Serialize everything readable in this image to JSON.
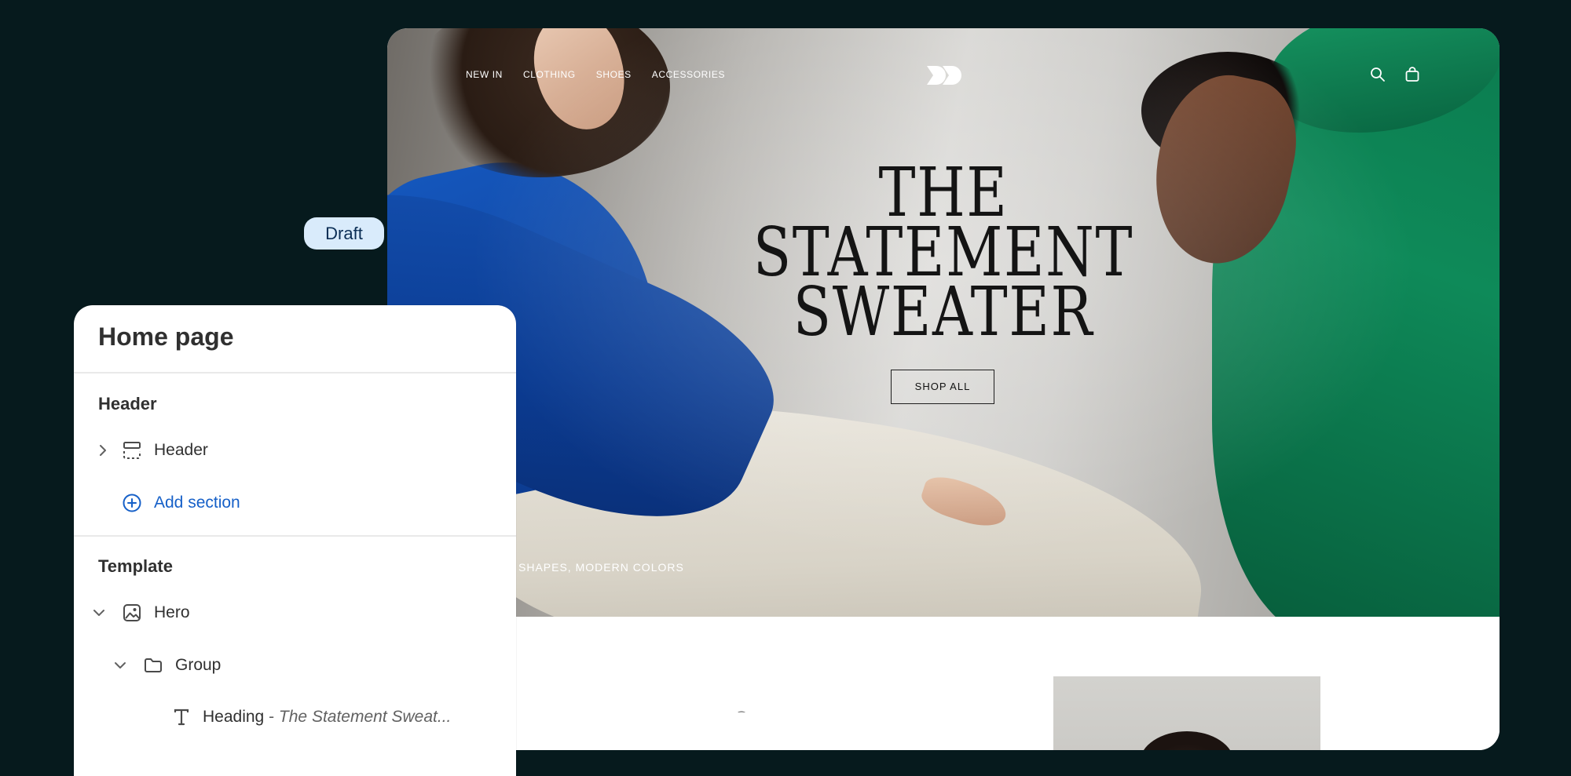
{
  "draft_badge": "Draft",
  "storefront": {
    "nav": [
      "NEW IN",
      "CLOTHING",
      "SHOES",
      "ACCESSORIES"
    ],
    "hero_title_lines": [
      "THE",
      "STATEMENT",
      "SWEATER"
    ],
    "shop_button": "SHOP ALL",
    "hero_caption": "SHAPES, MODERN COLORS",
    "icons": [
      "logo-icon",
      "search-icon",
      "cart-icon"
    ]
  },
  "panel": {
    "title": "Home page",
    "header_section": {
      "title": "Header",
      "items": [
        {
          "label": "Header",
          "icon": "header-layout-icon",
          "expanded": false
        }
      ],
      "add_label": "Add section"
    },
    "template_section": {
      "title": "Template",
      "hero": {
        "label": "Hero",
        "icon": "image-icon",
        "expanded": true
      },
      "group": {
        "label": "Group",
        "icon": "folder-icon",
        "expanded": true
      },
      "heading": {
        "label": "Heading",
        "separator": "-",
        "value": "The Statement Sweat..."
      }
    }
  }
}
